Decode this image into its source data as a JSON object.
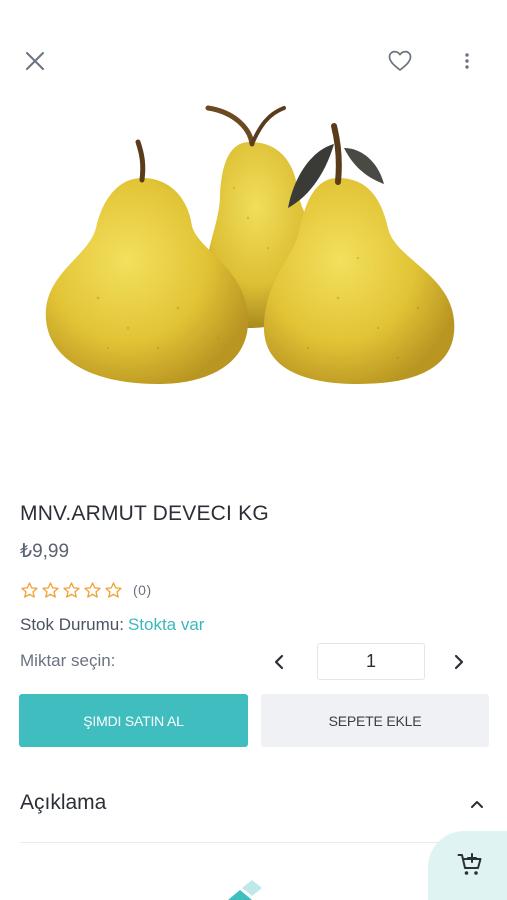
{
  "header": {
    "close_icon": "close-icon",
    "favorite_icon": "heart-icon",
    "more_icon": "more-vertical-icon"
  },
  "product": {
    "image_subject": "pears",
    "title": "MNV.ARMUT DEVECI KG",
    "price": "₺9,99",
    "rating": {
      "stars": 0,
      "max": 5,
      "count": "(0)"
    },
    "stock_label": "Stok Durumu:",
    "stock_value": "Stokta var"
  },
  "quantity": {
    "label": "Miktar seçin:",
    "value": "1",
    "decrement_icon": "chevron-left-icon",
    "increment_icon": "chevron-right-icon"
  },
  "actions": {
    "buy_now": "ŞIMDI SATIN AL",
    "add_to_cart": "SEPETE EKLE"
  },
  "description": {
    "title": "Açıklama",
    "toggle_icon": "chevron-up-icon"
  },
  "colors": {
    "accent": "#3fbdbf",
    "stock_text": "#3bb8bd",
    "star": "#f0a030",
    "secondary_button": "#eff1f4",
    "fab_background": "#dff4f2"
  },
  "fab": {
    "icon": "cart-add-icon"
  }
}
